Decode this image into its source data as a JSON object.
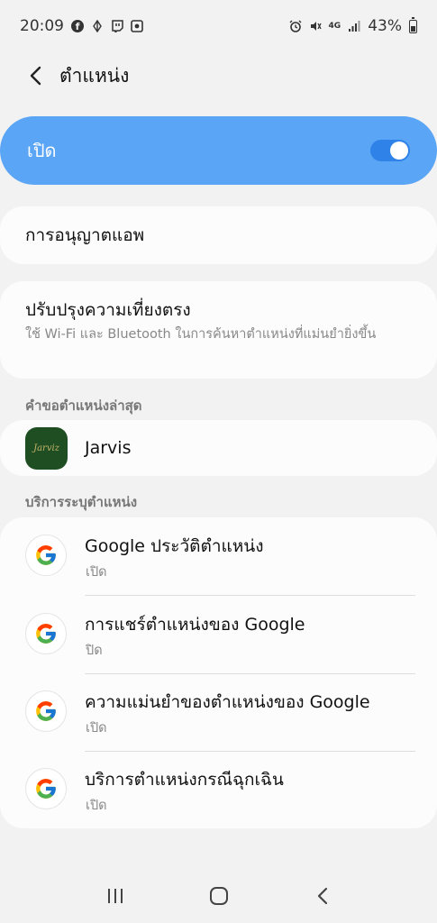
{
  "status_bar": {
    "time": "20:09",
    "network": "4G",
    "battery": "43%",
    "icons": [
      "facebook-icon",
      "diamond-icon",
      "twitch-icon",
      "square-app-icon",
      "alarm-icon",
      "mute-icon",
      "signal-icon",
      "battery-icon"
    ]
  },
  "header": {
    "title": "ตำแหน่ง",
    "back_icon": "back-arrow-icon"
  },
  "master_switch": {
    "label": "เปิด",
    "on": true,
    "color": "#5aa5f5"
  },
  "app_permissions": {
    "label": "การอนุญาตแอพ"
  },
  "accuracy": {
    "title": "ปรับปรุงความเที่ยงตรง",
    "description": "ใช้ Wi-Fi และ Bluetooth ในการค้นหาตำแหน่งที่แม่นยำยิ่งขึ้น"
  },
  "recent_requests": {
    "header": "คำขอตำแหน่งล่าสุด",
    "items": [
      {
        "name": "Jarvis",
        "icon_text": "Jarviz"
      }
    ]
  },
  "location_services": {
    "header": "บริการระบุตำแหน่ง",
    "items": [
      {
        "title": "Google ประวัติตำแหน่ง",
        "status": "เปิด"
      },
      {
        "title": "การแชร์ตำแหน่งของ Google",
        "status": "ปิด"
      },
      {
        "title": "ความแม่นยำของตำแหน่งของ Google",
        "status": "เปิด"
      },
      {
        "title": "บริการตำแหน่งกรณีฉุกเฉิน",
        "status": "เปิด"
      }
    ]
  },
  "nav_bar": {
    "icons": [
      "recents-icon",
      "home-icon",
      "back-icon"
    ]
  }
}
